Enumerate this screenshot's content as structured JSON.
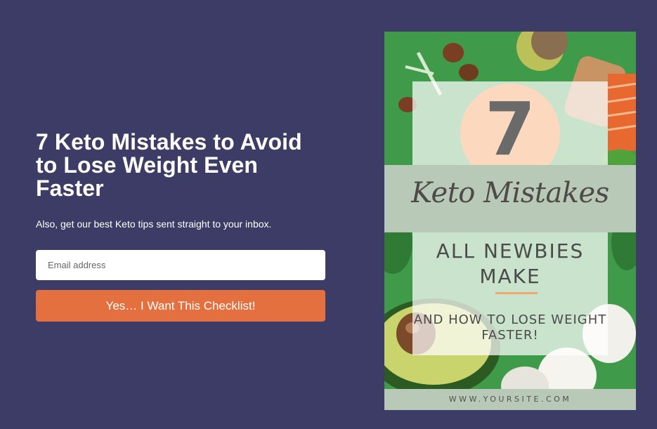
{
  "optin": {
    "headline": "7 Keto Mistakes to Avoid to Lose Weight Even Faster",
    "subtext": "Also, get our best Keto tips sent straight to your inbox.",
    "email_placeholder": "Email address",
    "cta_label": "Yes… I Want This Checklist!"
  },
  "cover": {
    "number": "7",
    "script_title": "Keto Mistakes",
    "subtitle": "ALL NEWBIES MAKE",
    "tagline": "AND HOW TO LOSE WEIGHT FASTER!",
    "website": "WWW.YOURSITE.COM"
  },
  "colors": {
    "background": "#3c3c66",
    "button": "#e3703e",
    "cover_green": "#3f9a4a",
    "cover_circle": "#fcd9be",
    "cover_band": "#b8c9b8"
  }
}
